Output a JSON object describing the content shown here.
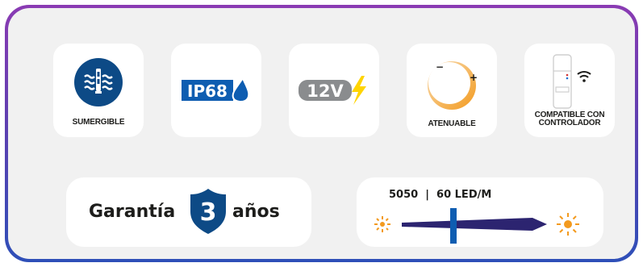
{
  "features": {
    "submersible": {
      "label": "SUMERGIBLE",
      "icon": "submersible-icon"
    },
    "ip": {
      "badge": "IP68",
      "icon": "water-drop-icon"
    },
    "voltage": {
      "badge": "12V",
      "icon": "lightning-bolt-icon"
    },
    "dimmable": {
      "label": "ATENUABLE",
      "minus": "−",
      "plus": "+",
      "icon": "dimmer-dial-icon"
    },
    "controller": {
      "label_line1": "COMPATIBLE CON",
      "label_line2": "CONTROLADOR",
      "icon": "remote-wifi-icon"
    }
  },
  "warranty": {
    "before": "Garantía",
    "number": "3",
    "after": "años",
    "icon": "shield-icon"
  },
  "led": {
    "spec": "5050  |  60 LED/M",
    "icon": "led-strip-icon"
  },
  "colors": {
    "navy": "#0d4a86",
    "blue": "#0e5db1",
    "gray": "#8a8c8e",
    "yellow": "#f5c400",
    "orange": "#f39a1e",
    "bolt": "#ffd400"
  }
}
